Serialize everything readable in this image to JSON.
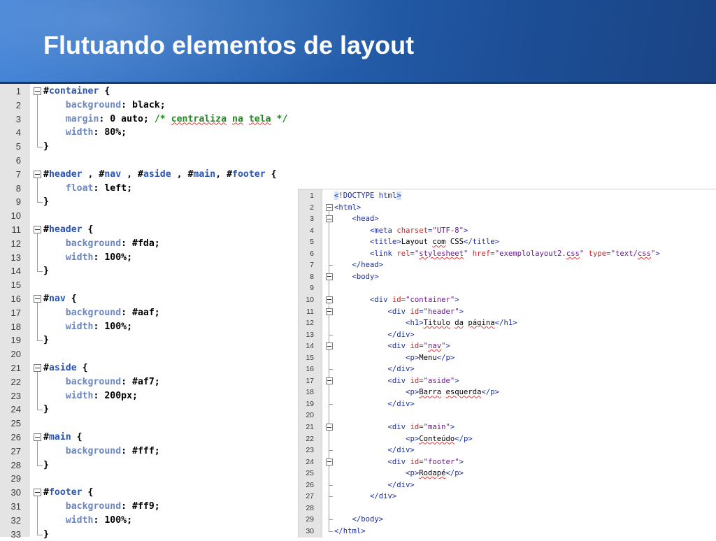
{
  "slide": {
    "title": "Flutuando elementos de layout"
  },
  "css_editor": {
    "lines": [
      {
        "n": "1",
        "tokens": [
          {
            "t": "#",
            "c": "sel"
          },
          {
            "t": "container",
            "c": "kw"
          },
          {
            "t": " {",
            "c": "val"
          }
        ]
      },
      {
        "n": "2",
        "tokens": [
          {
            "t": "    "
          },
          {
            "t": "background",
            "c": "prop"
          },
          {
            "t": ": black;",
            "c": "val"
          }
        ]
      },
      {
        "n": "3",
        "tokens": [
          {
            "t": "    "
          },
          {
            "t": "margin",
            "c": "prop"
          },
          {
            "t": ": 0 auto; ",
            "c": "val"
          },
          {
            "t": "/* ",
            "c": "cmt"
          },
          {
            "t": "centraliza",
            "c": "cmt sq"
          },
          {
            "t": " ",
            "c": "cmt"
          },
          {
            "t": "na",
            "c": "cmt sq"
          },
          {
            "t": " ",
            "c": "cmt"
          },
          {
            "t": "tela",
            "c": "cmt sq"
          },
          {
            "t": " */",
            "c": "cmt"
          }
        ]
      },
      {
        "n": "4",
        "tokens": [
          {
            "t": "    "
          },
          {
            "t": "width",
            "c": "prop"
          },
          {
            "t": ": 80%;",
            "c": "val"
          }
        ]
      },
      {
        "n": "5",
        "tokens": [
          {
            "t": "}",
            "c": "val"
          }
        ]
      },
      {
        "n": "6",
        "tokens": []
      },
      {
        "n": "7",
        "tokens": [
          {
            "t": "#",
            "c": "sel"
          },
          {
            "t": "header",
            "c": "kw"
          },
          {
            "t": " , #",
            "c": "val"
          },
          {
            "t": "nav",
            "c": "kw"
          },
          {
            "t": " , #",
            "c": "val"
          },
          {
            "t": "aside",
            "c": "kw"
          },
          {
            "t": " , #",
            "c": "val"
          },
          {
            "t": "main",
            "c": "kw"
          },
          {
            "t": ", #",
            "c": "val"
          },
          {
            "t": "footer",
            "c": "kw"
          },
          {
            "t": " {",
            "c": "val"
          }
        ]
      },
      {
        "n": "8",
        "tokens": [
          {
            "t": "    "
          },
          {
            "t": "float",
            "c": "prop"
          },
          {
            "t": ": left;",
            "c": "val"
          }
        ]
      },
      {
        "n": "9",
        "tokens": [
          {
            "t": "}",
            "c": "val"
          }
        ]
      },
      {
        "n": "10",
        "tokens": []
      },
      {
        "n": "11",
        "tokens": [
          {
            "t": "#",
            "c": "sel"
          },
          {
            "t": "header",
            "c": "kw"
          },
          {
            "t": " {",
            "c": "val"
          }
        ]
      },
      {
        "n": "12",
        "tokens": [
          {
            "t": "    "
          },
          {
            "t": "background",
            "c": "prop"
          },
          {
            "t": ": #fda;",
            "c": "val"
          }
        ]
      },
      {
        "n": "13",
        "tokens": [
          {
            "t": "    "
          },
          {
            "t": "width",
            "c": "prop"
          },
          {
            "t": ": 100%;",
            "c": "val"
          }
        ]
      },
      {
        "n": "14",
        "tokens": [
          {
            "t": "}",
            "c": "val"
          }
        ]
      },
      {
        "n": "15",
        "tokens": []
      },
      {
        "n": "16",
        "tokens": [
          {
            "t": "#",
            "c": "sel"
          },
          {
            "t": "nav",
            "c": "kw"
          },
          {
            "t": " {",
            "c": "val"
          }
        ]
      },
      {
        "n": "17",
        "tokens": [
          {
            "t": "    "
          },
          {
            "t": "background",
            "c": "prop"
          },
          {
            "t": ": #aaf;",
            "c": "val"
          }
        ]
      },
      {
        "n": "18",
        "tokens": [
          {
            "t": "    "
          },
          {
            "t": "width",
            "c": "prop"
          },
          {
            "t": ": 100%;",
            "c": "val"
          }
        ]
      },
      {
        "n": "19",
        "tokens": [
          {
            "t": "}",
            "c": "val"
          }
        ]
      },
      {
        "n": "20",
        "tokens": []
      },
      {
        "n": "21",
        "tokens": [
          {
            "t": "#",
            "c": "sel"
          },
          {
            "t": "aside",
            "c": "kw"
          },
          {
            "t": " {",
            "c": "val"
          }
        ]
      },
      {
        "n": "22",
        "tokens": [
          {
            "t": "    "
          },
          {
            "t": "background",
            "c": "prop"
          },
          {
            "t": ": #af7;",
            "c": "val"
          }
        ]
      },
      {
        "n": "23",
        "tokens": [
          {
            "t": "    "
          },
          {
            "t": "width",
            "c": "prop"
          },
          {
            "t": ": 200px;",
            "c": "val"
          }
        ]
      },
      {
        "n": "24",
        "tokens": [
          {
            "t": "}",
            "c": "val"
          }
        ]
      },
      {
        "n": "25",
        "tokens": []
      },
      {
        "n": "26",
        "tokens": [
          {
            "t": "#",
            "c": "sel"
          },
          {
            "t": "main",
            "c": "kw"
          },
          {
            "t": " {",
            "c": "val"
          }
        ]
      },
      {
        "n": "27",
        "tokens": [
          {
            "t": "    "
          },
          {
            "t": "background",
            "c": "prop"
          },
          {
            "t": ": #fff;",
            "c": "val"
          }
        ]
      },
      {
        "n": "28",
        "tokens": [
          {
            "t": "}",
            "c": "val"
          }
        ]
      },
      {
        "n": "29",
        "tokens": []
      },
      {
        "n": "30",
        "tokens": [
          {
            "t": "#",
            "c": "sel"
          },
          {
            "t": "footer",
            "c": "kw"
          },
          {
            "t": " {",
            "c": "val"
          }
        ]
      },
      {
        "n": "31",
        "tokens": [
          {
            "t": "    "
          },
          {
            "t": "background",
            "c": "prop"
          },
          {
            "t": ": #ff9;",
            "c": "val"
          }
        ]
      },
      {
        "n": "32",
        "tokens": [
          {
            "t": "    "
          },
          {
            "t": "width",
            "c": "prop"
          },
          {
            "t": ": 100%;",
            "c": "val"
          }
        ]
      },
      {
        "n": "33",
        "tokens": [
          {
            "t": "}",
            "c": "val"
          }
        ]
      }
    ],
    "folds": {
      "open": [
        1,
        7,
        11,
        16,
        21,
        26,
        30
      ],
      "close": [
        5,
        9,
        14,
        19,
        24,
        28,
        33
      ]
    }
  },
  "html_editor": {
    "lines": [
      {
        "n": "1",
        "tokens": [
          {
            "t": "<",
            "c": "t hl"
          },
          {
            "t": "!DOCTYPE html",
            "c": "t"
          },
          {
            "t": ">",
            "c": "t hl"
          }
        ]
      },
      {
        "n": "2",
        "tokens": [
          {
            "t": "<html>",
            "c": "t"
          }
        ]
      },
      {
        "n": "3",
        "tokens": [
          {
            "t": "    "
          },
          {
            "t": "<head>",
            "c": "t"
          }
        ]
      },
      {
        "n": "4",
        "tokens": [
          {
            "t": "        "
          },
          {
            "t": "<meta ",
            "c": "t"
          },
          {
            "t": "charset",
            "c": "an"
          },
          {
            "t": "=",
            "c": "t"
          },
          {
            "t": "\"UTF-8\"",
            "c": "av"
          },
          {
            "t": ">",
            "c": "t"
          }
        ]
      },
      {
        "n": "5",
        "tokens": [
          {
            "t": "        "
          },
          {
            "t": "<title>",
            "c": "t"
          },
          {
            "t": "Layout "
          },
          {
            "t": "com",
            "c": "sq"
          },
          {
            "t": " CSS"
          },
          {
            "t": "</title>",
            "c": "t"
          }
        ]
      },
      {
        "n": "6",
        "tokens": [
          {
            "t": "        "
          },
          {
            "t": "<link ",
            "c": "t"
          },
          {
            "t": "rel",
            "c": "an"
          },
          {
            "t": "=",
            "c": "t"
          },
          {
            "t": "\"",
            "c": "av"
          },
          {
            "t": "stylesheet",
            "c": "av sq"
          },
          {
            "t": "\" ",
            "c": "av"
          },
          {
            "t": "href",
            "c": "an"
          },
          {
            "t": "=",
            "c": "t"
          },
          {
            "t": "\"exemplolayout2.",
            "c": "av"
          },
          {
            "t": "css",
            "c": "av sq"
          },
          {
            "t": "\" ",
            "c": "av"
          },
          {
            "t": "type",
            "c": "an"
          },
          {
            "t": "=",
            "c": "t"
          },
          {
            "t": "\"text/",
            "c": "av"
          },
          {
            "t": "css",
            "c": "av sq"
          },
          {
            "t": "\"",
            "c": "av"
          },
          {
            "t": ">",
            "c": "t"
          }
        ]
      },
      {
        "n": "7",
        "tokens": [
          {
            "t": "    "
          },
          {
            "t": "</head>",
            "c": "t"
          }
        ]
      },
      {
        "n": "8",
        "tokens": [
          {
            "t": "    "
          },
          {
            "t": "<body>",
            "c": "t"
          }
        ]
      },
      {
        "n": "9",
        "tokens": []
      },
      {
        "n": "10",
        "tokens": [
          {
            "t": "        "
          },
          {
            "t": "<div ",
            "c": "t"
          },
          {
            "t": "id",
            "c": "an"
          },
          {
            "t": "=",
            "c": "t"
          },
          {
            "t": "\"container\"",
            "c": "av"
          },
          {
            "t": ">",
            "c": "t"
          }
        ]
      },
      {
        "n": "11",
        "tokens": [
          {
            "t": "            "
          },
          {
            "t": "<div ",
            "c": "t"
          },
          {
            "t": "id",
            "c": "an"
          },
          {
            "t": "=",
            "c": "t"
          },
          {
            "t": "\"header\"",
            "c": "av"
          },
          {
            "t": ">",
            "c": "t"
          }
        ]
      },
      {
        "n": "12",
        "tokens": [
          {
            "t": "                "
          },
          {
            "t": "<h1>",
            "c": "t"
          },
          {
            "t": "Titulo",
            "c": "sq"
          },
          {
            "t": " "
          },
          {
            "t": "da",
            "c": "sq"
          },
          {
            "t": " "
          },
          {
            "t": "página",
            "c": "sq"
          },
          {
            "t": "</h1>",
            "c": "t"
          }
        ]
      },
      {
        "n": "13",
        "tokens": [
          {
            "t": "            "
          },
          {
            "t": "</div>",
            "c": "t"
          }
        ]
      },
      {
        "n": "14",
        "tokens": [
          {
            "t": "            "
          },
          {
            "t": "<div ",
            "c": "t"
          },
          {
            "t": "id",
            "c": "an"
          },
          {
            "t": "=",
            "c": "t"
          },
          {
            "t": "\"",
            "c": "av"
          },
          {
            "t": "nav",
            "c": "av sq"
          },
          {
            "t": "\"",
            "c": "av"
          },
          {
            "t": ">",
            "c": "t"
          }
        ]
      },
      {
        "n": "15",
        "tokens": [
          {
            "t": "                "
          },
          {
            "t": "<p>",
            "c": "t"
          },
          {
            "t": "Menu"
          },
          {
            "t": "</p>",
            "c": "t"
          }
        ]
      },
      {
        "n": "16",
        "tokens": [
          {
            "t": "            "
          },
          {
            "t": "</div>",
            "c": "t"
          }
        ]
      },
      {
        "n": "17",
        "tokens": [
          {
            "t": "            "
          },
          {
            "t": "<div ",
            "c": "t"
          },
          {
            "t": "id",
            "c": "an"
          },
          {
            "t": "=",
            "c": "t"
          },
          {
            "t": "\"aside\"",
            "c": "av"
          },
          {
            "t": ">",
            "c": "t"
          }
        ]
      },
      {
        "n": "18",
        "tokens": [
          {
            "t": "                "
          },
          {
            "t": "<p>",
            "c": "t"
          },
          {
            "t": "Barra",
            "c": "sq"
          },
          {
            "t": " "
          },
          {
            "t": "esquerda",
            "c": "sq"
          },
          {
            "t": "</p>",
            "c": "t"
          }
        ]
      },
      {
        "n": "19",
        "tokens": [
          {
            "t": "            "
          },
          {
            "t": "</div>",
            "c": "t"
          }
        ]
      },
      {
        "n": "20",
        "tokens": []
      },
      {
        "n": "21",
        "tokens": [
          {
            "t": "            "
          },
          {
            "t": "<div ",
            "c": "t"
          },
          {
            "t": "id",
            "c": "an"
          },
          {
            "t": "=",
            "c": "t"
          },
          {
            "t": "\"main\"",
            "c": "av"
          },
          {
            "t": ">",
            "c": "t"
          }
        ]
      },
      {
        "n": "22",
        "tokens": [
          {
            "t": "                "
          },
          {
            "t": "<p>",
            "c": "t"
          },
          {
            "t": "Conteúdo",
            "c": "sq"
          },
          {
            "t": "</p>",
            "c": "t"
          }
        ]
      },
      {
        "n": "23",
        "tokens": [
          {
            "t": "            "
          },
          {
            "t": "</div>",
            "c": "t"
          }
        ]
      },
      {
        "n": "24",
        "tokens": [
          {
            "t": "            "
          },
          {
            "t": "<div ",
            "c": "t"
          },
          {
            "t": "id",
            "c": "an"
          },
          {
            "t": "=",
            "c": "t"
          },
          {
            "t": "\"footer\"",
            "c": "av"
          },
          {
            "t": ">",
            "c": "t"
          }
        ]
      },
      {
        "n": "25",
        "tokens": [
          {
            "t": "                "
          },
          {
            "t": "<p>",
            "c": "t"
          },
          {
            "t": "Rodapé",
            "c": "sq"
          },
          {
            "t": "</p>",
            "c": "t"
          }
        ]
      },
      {
        "n": "26",
        "tokens": [
          {
            "t": "            "
          },
          {
            "t": "</div>",
            "c": "t"
          }
        ]
      },
      {
        "n": "27",
        "tokens": [
          {
            "t": "        "
          },
          {
            "t": "</div>",
            "c": "t"
          }
        ]
      },
      {
        "n": "28",
        "tokens": []
      },
      {
        "n": "29",
        "tokens": [
          {
            "t": "    "
          },
          {
            "t": "</body>",
            "c": "t"
          }
        ]
      },
      {
        "n": "30",
        "tokens": [
          {
            "t": "</html>",
            "c": "t"
          }
        ]
      }
    ],
    "folds": {
      "open": [
        2,
        3,
        8,
        10,
        11,
        14,
        17,
        21,
        24
      ],
      "close": [
        7,
        13,
        16,
        19,
        23,
        26,
        27,
        29,
        30
      ]
    }
  }
}
